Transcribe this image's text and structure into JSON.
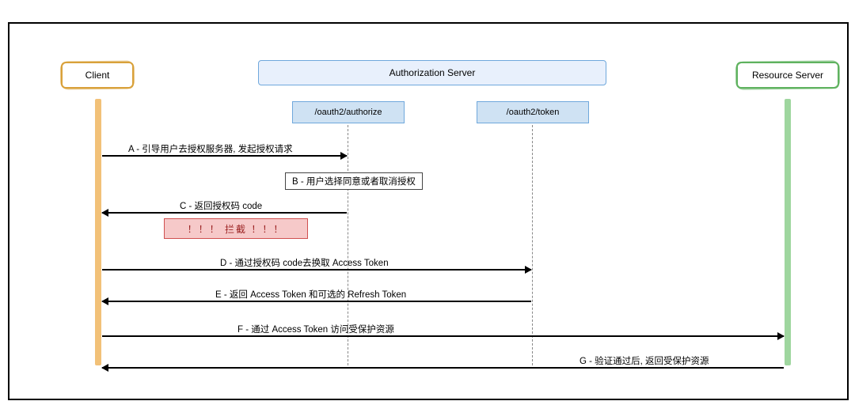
{
  "participants": {
    "client": "Client",
    "authServer": "Authorization Server",
    "resourceServer": "Resource Server"
  },
  "endpoints": {
    "authorize": "/oauth2/authorize",
    "token": "/oauth2/token"
  },
  "messages": {
    "A": "A - 引导用户去授权服务器, 发起授权请求",
    "B": "B - 用户选择同意或者取消授权",
    "C": "C - 返回授权码 code",
    "D": "D - 通过授权码 code去换取 Access Token",
    "E": "E - 返回 Access Token 和可选的 Refresh Token",
    "F": "F - 通过 Access Token 访问受保护资源",
    "G": "G - 验证通过后, 返回受保护资源"
  },
  "intercept": "！！！   拦截   ！！！",
  "chart_data": {
    "type": "sequence",
    "participants": [
      "Client",
      "Authorization Server",
      "Resource Server"
    ],
    "sub_endpoints": {
      "Authorization Server": [
        "/oauth2/authorize",
        "/oauth2/token"
      ]
    },
    "steps": [
      {
        "id": "A",
        "from": "Client",
        "to": "/oauth2/authorize",
        "text": "引导用户去授权服务器, 发起授权请求"
      },
      {
        "id": "B",
        "at": "/oauth2/authorize",
        "self": true,
        "text": "用户选择同意或者取消授权"
      },
      {
        "id": "C",
        "from": "/oauth2/authorize",
        "to": "Client",
        "text": "返回授权码 code",
        "note": "拦截"
      },
      {
        "id": "D",
        "from": "Client",
        "to": "/oauth2/token",
        "text": "通过授权码 code去换取 Access Token"
      },
      {
        "id": "E",
        "from": "/oauth2/token",
        "to": "Client",
        "text": "返回 Access Token 和可选的 Refresh Token"
      },
      {
        "id": "F",
        "from": "Client",
        "to": "Resource Server",
        "text": "通过 Access Token 访问受保护资源"
      },
      {
        "id": "G",
        "from": "Resource Server",
        "to": "Client",
        "text": "验证通过后, 返回受保护资源"
      }
    ]
  }
}
